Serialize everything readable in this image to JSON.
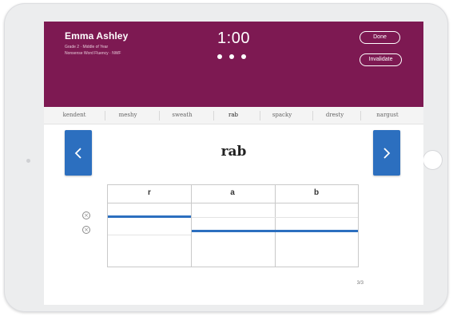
{
  "header": {
    "student_name": "Emma Ashley",
    "grade_line": "Grade 2 · Middle of Year",
    "assessment_line": "Nonsense Word Fluency · NWF",
    "timer": "1:00",
    "done_label": "Done",
    "invalidate_label": "Invalidate"
  },
  "word_strip": [
    "kendent",
    "meshy",
    "sweath",
    "rab",
    "spacky",
    "dresty",
    "nargust"
  ],
  "current_word": "rab",
  "phonemes": [
    "r",
    "a",
    "b"
  ],
  "page_count": "3/3",
  "icons": {
    "prev": "chevron-left-icon",
    "next": "chevron-right-icon",
    "clear": "clear-circle-icon"
  },
  "colors": {
    "header_bg": "#7d1952",
    "accent_blue": "#2c6fbf"
  }
}
